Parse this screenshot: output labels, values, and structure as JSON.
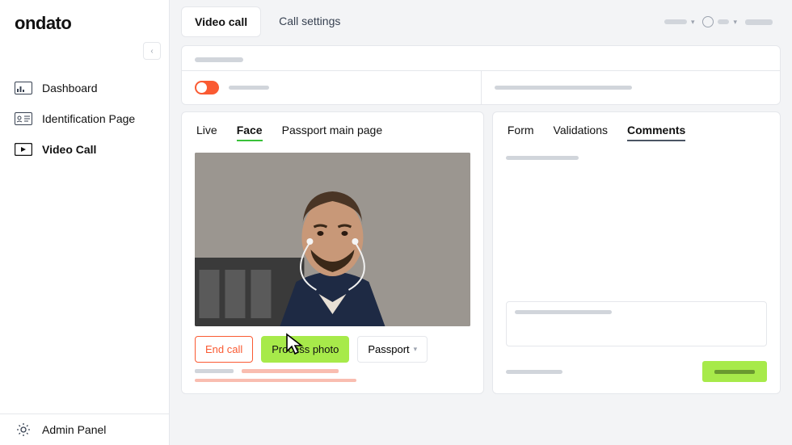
{
  "brand": "ondato",
  "sidebar": {
    "items": [
      {
        "label": "Dashboard"
      },
      {
        "label": "Identification Page"
      },
      {
        "label": "Video Call"
      }
    ],
    "footer": {
      "label": "Admin Panel"
    }
  },
  "topbar": {
    "tabs": [
      "Video call",
      "Call settings"
    ],
    "active": 0
  },
  "left_panel": {
    "tabs": [
      "Live",
      "Face",
      "Passport main page"
    ],
    "active": 1,
    "buttons": {
      "end_call": "End call",
      "process_photo": "Process photo",
      "passport": "Passport"
    }
  },
  "right_panel": {
    "tabs": [
      "Form",
      "Validations",
      "Comments"
    ],
    "active": 2
  },
  "colors": {
    "accent_orange": "#fa5a32",
    "accent_green": "#a7ea4a",
    "tab_underline": "#3ac13a"
  }
}
